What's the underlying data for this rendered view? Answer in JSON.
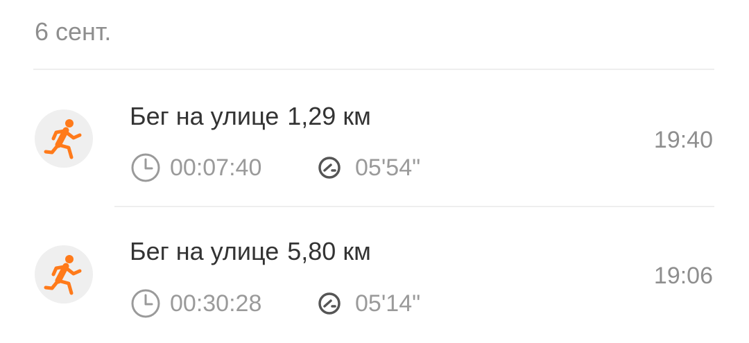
{
  "date_header": "6 сент.",
  "accent_color": "#ff7a1a",
  "workouts": [
    {
      "icon": "running-icon",
      "title": "Бег на улице",
      "distance": "1,29 км",
      "duration": "00:07:40",
      "pace": "05'54\"",
      "time": "19:40"
    },
    {
      "icon": "running-icon",
      "title": "Бег на улице",
      "distance": "5,80 км",
      "duration": "00:30:28",
      "pace": "05'14\"",
      "time": "19:06"
    }
  ]
}
